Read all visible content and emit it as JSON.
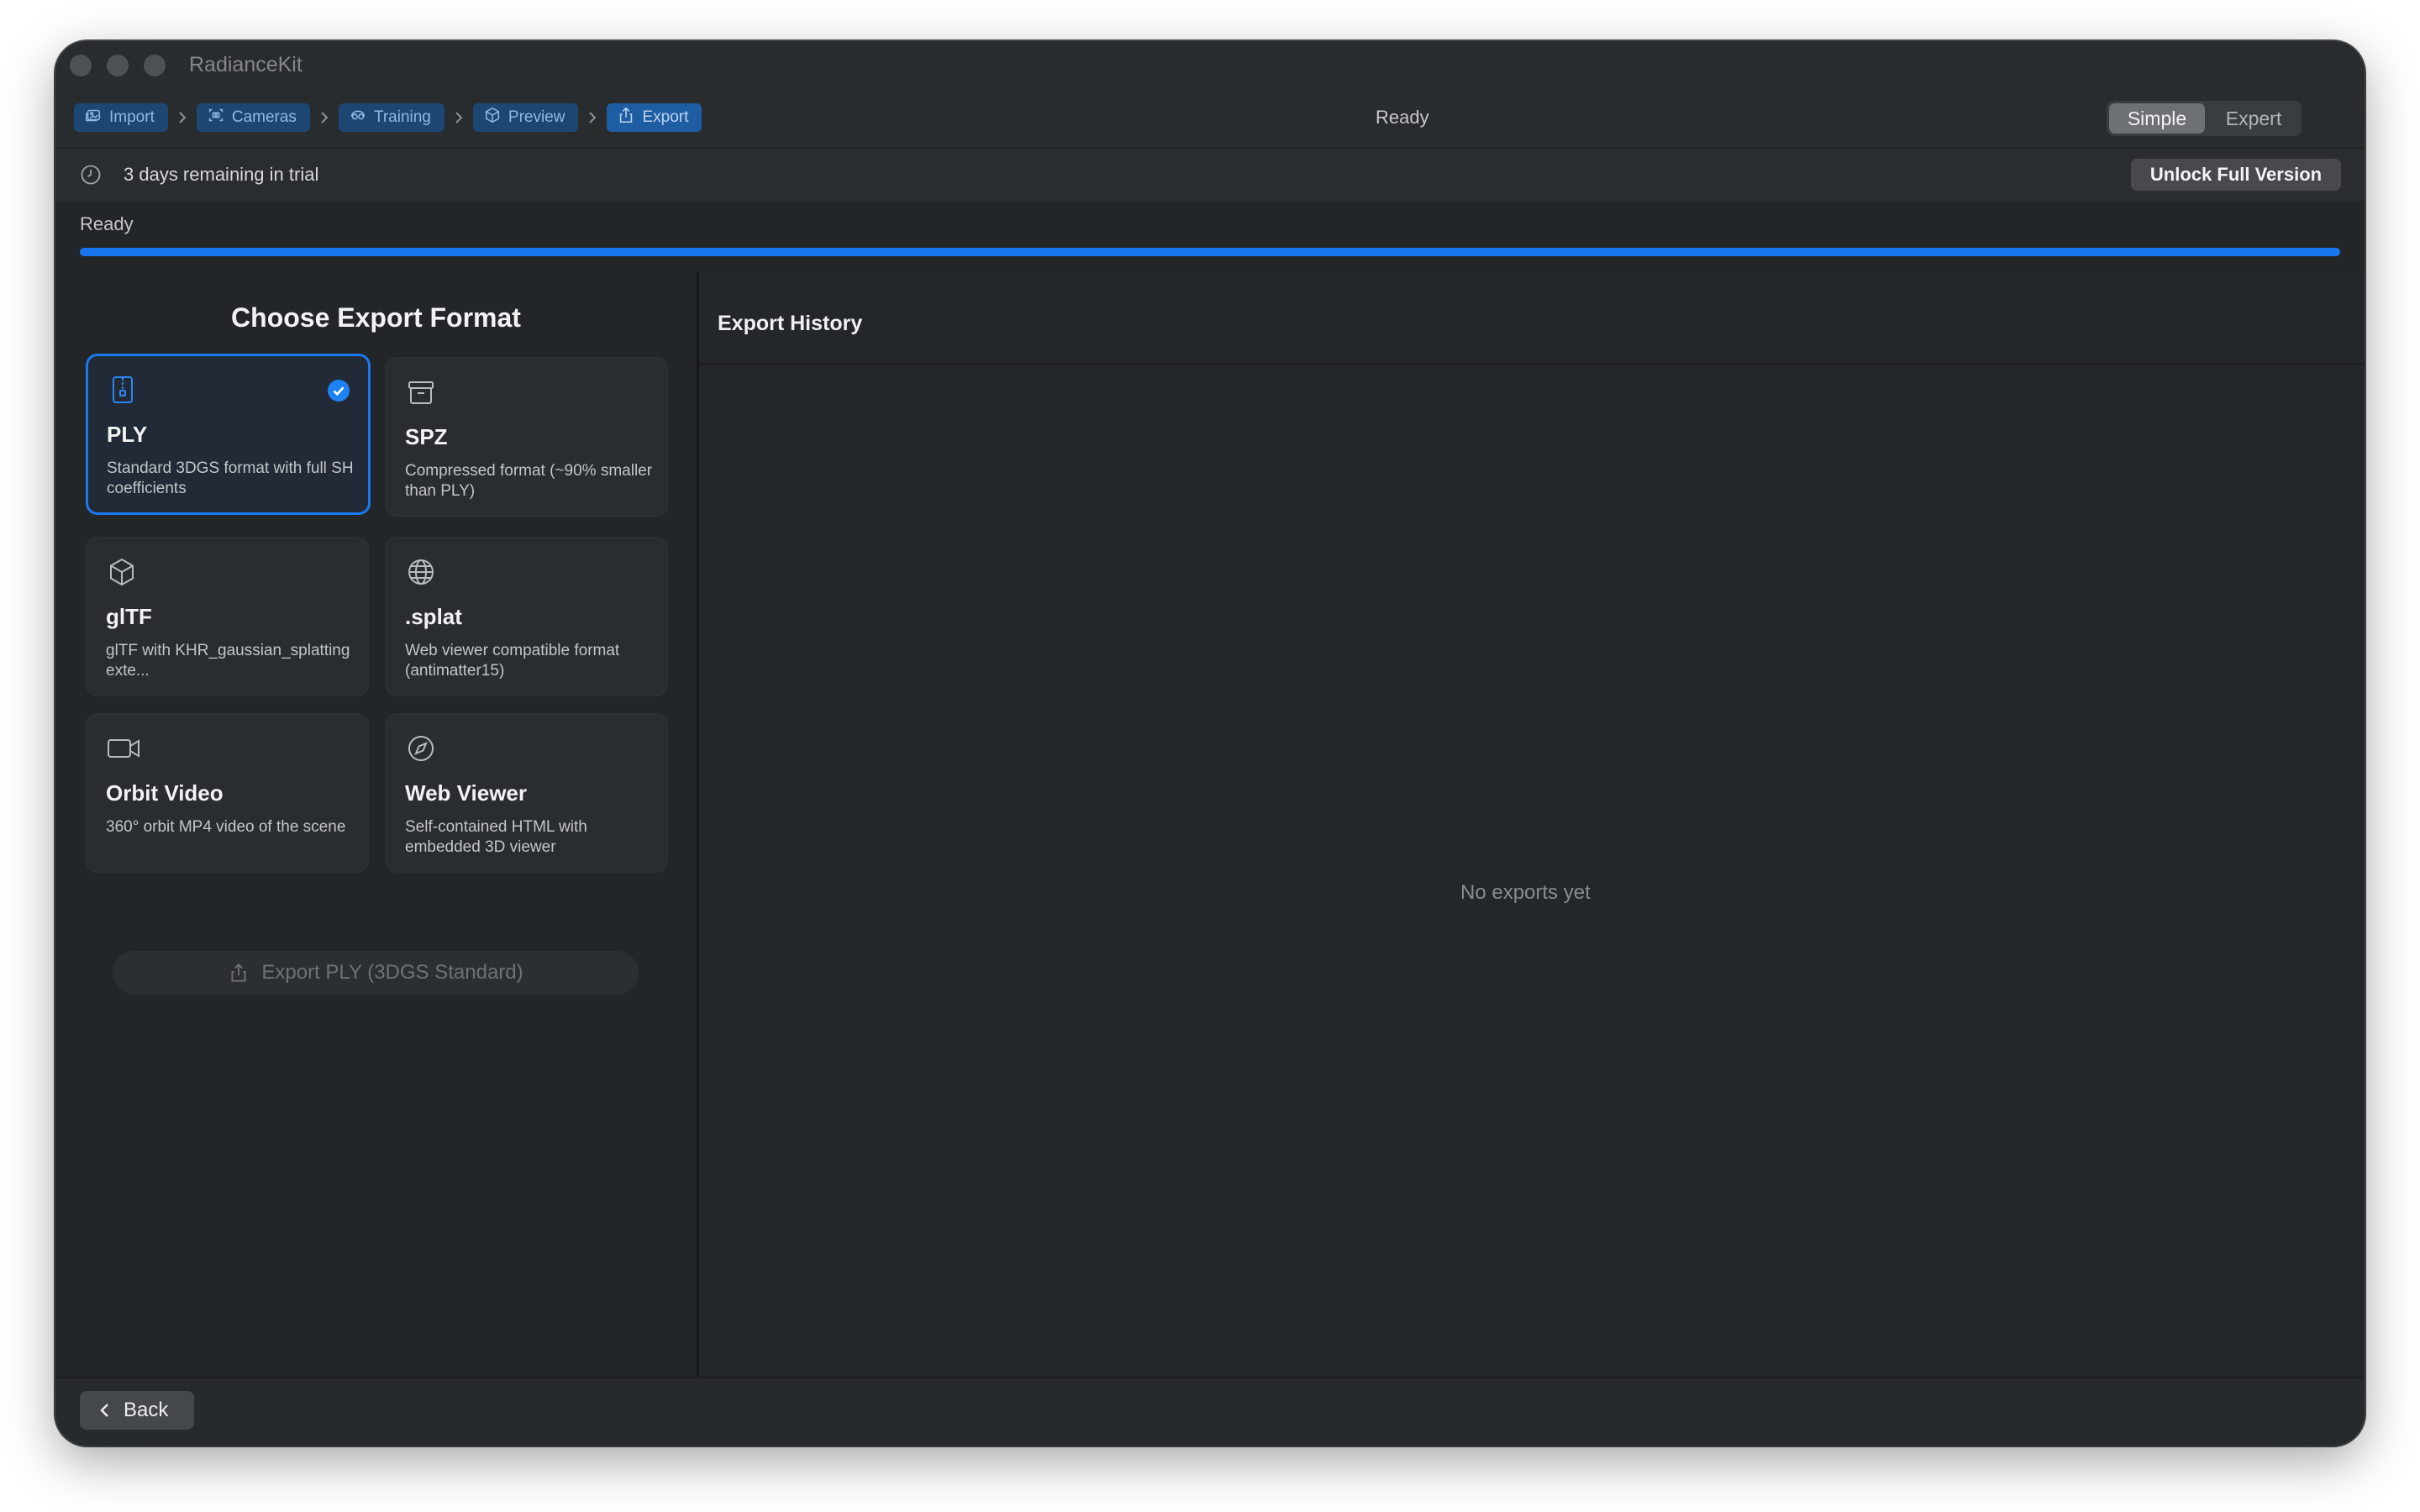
{
  "app": {
    "title": "RadianceKit",
    "status": "Ready"
  },
  "breadcrumbs": [
    {
      "label": "Import",
      "icon": "photo-import-icon"
    },
    {
      "label": "Cameras",
      "icon": "camera-focus-icon"
    },
    {
      "label": "Training",
      "icon": "training-icon"
    },
    {
      "label": "Preview",
      "icon": "cube-preview-icon"
    },
    {
      "label": "Export",
      "icon": "share-export-icon",
      "active": true
    }
  ],
  "mode_toggle": {
    "options": [
      "Simple",
      "Expert"
    ],
    "selected": "Simple"
  },
  "trial": {
    "text": "3 days remaining in trial",
    "unlock_label": "Unlock Full Version"
  },
  "progress": {
    "label": "Ready",
    "fraction": 1.0,
    "color": "#1877ee"
  },
  "export": {
    "heading": "Choose Export Format",
    "formats": [
      {
        "title": "PLY",
        "desc": "Standard 3DGS format with full SH coefficients",
        "icon": "file-zipper-icon",
        "selected": true
      },
      {
        "title": "SPZ",
        "desc": "Compressed format (~90% smaller than PLY)",
        "icon": "archive-box-icon",
        "selected": false
      },
      {
        "title": "glTF",
        "desc": "glTF with KHR_gaussian_splatting exte...",
        "icon": "cube-icon",
        "selected": false
      },
      {
        "title": ".splat",
        "desc": "Web viewer compatible format (antimatter15)",
        "icon": "globe-icon",
        "selected": false
      },
      {
        "title": "Orbit Video",
        "desc": "360° orbit MP4 video of the scene",
        "icon": "video-camera-icon",
        "selected": false
      },
      {
        "title": "Web Viewer",
        "desc": "Self-contained HTML with embedded 3D viewer",
        "icon": "compass-icon",
        "selected": false
      }
    ],
    "button_label": "Export PLY (3DGS Standard)"
  },
  "history": {
    "title": "Export History",
    "empty_text": "No exports yet"
  },
  "footer": {
    "back_label": "Back"
  },
  "colors": {
    "accent": "#1b78ee",
    "window_bg": "#232628"
  }
}
